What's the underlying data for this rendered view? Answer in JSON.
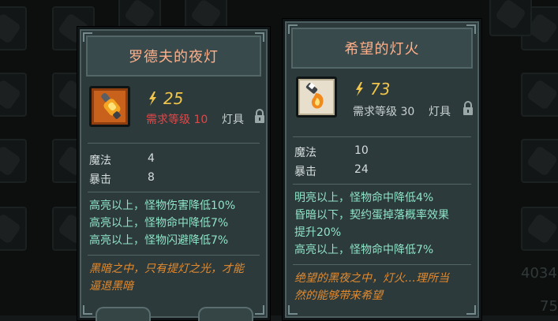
{
  "background": {
    "numbers": [
      "4034",
      "75"
    ]
  },
  "cards": [
    {
      "title": "罗德夫的夜灯",
      "icon": "lantern-torch-icon",
      "power_value": "25",
      "requirement": "需求等级 10",
      "requirement_color": "#e04848",
      "item_type": "灯具",
      "stats": [
        {
          "label": "魔法",
          "value": "4"
        },
        {
          "label": "暴击",
          "value": "8"
        }
      ],
      "effects": [
        "高亮以上，怪物伤害降低10%",
        "高亮以上，怪物命中降低7%",
        "高亮以上，怪物闪避降低7%"
      ],
      "flavor": [
        "黑暗之中，只有提灯之光，才能",
        "逼退黑暗"
      ]
    },
    {
      "title": "希望的灯火",
      "icon": "hope-flame-icon",
      "power_value": "73",
      "requirement": "需求等级 30",
      "requirement_color": "#c9d2d2",
      "item_type": "灯具",
      "stats": [
        {
          "label": "魔法",
          "value": "10"
        },
        {
          "label": "暴击",
          "value": "24"
        }
      ],
      "effects": [
        "明亮以上，怪物命中降低4%",
        "昏暗以下，契约蛋掉落概率效果",
        "提升20%",
        "高亮以上，怪物命中降低7%"
      ],
      "flavor": [
        "绝望的黑夜之中，灯火…理所当",
        "然的能够带来希望"
      ]
    }
  ],
  "colors": {
    "title": "#ffb08a",
    "power": "#f0c54a",
    "effect": "#8fe3c6",
    "flavor": "#e38a2e"
  }
}
